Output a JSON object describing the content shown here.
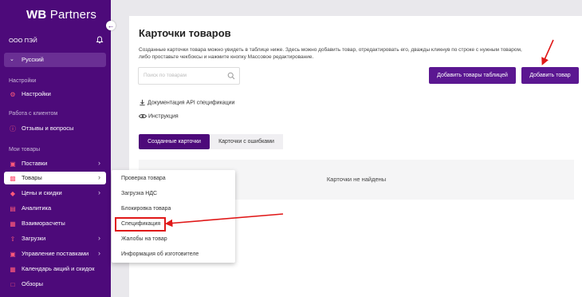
{
  "sidebar": {
    "logo_wb": "WB",
    "logo_partners": "Partners",
    "org_name": "ООО ПЭЙ",
    "language": "Русский",
    "sections": {
      "settings": "Настройки",
      "work_with_client": "Работа с клиентом",
      "my_goods": "Мои товары"
    },
    "items": {
      "settings": "Настройки",
      "reviews": "Отзывы и вопросы",
      "supplies": "Поставки",
      "goods": "Товары",
      "prices": "Цены и скидки",
      "analytics": "Аналитика",
      "settlements": "Взаиморасчеты",
      "uploads": "Загрузки",
      "supply_management": "Управление поставками",
      "promo_calendar": "Календарь акций и скидок",
      "reviews_overview": "Обзоры"
    }
  },
  "main": {
    "title": "Карточки товаров",
    "description": "Созданные карточки товара можно увидеть в таблице ниже. Здесь можно добавить товар, отредактировать его, дважды кликнув по строке с нужным товаром, либо проставьте чекбоксы и нажмите кнопку Массовое редактирование.",
    "search_placeholder": "Поиск по товарам",
    "add_table_button": "Добавить товары таблицей",
    "add_product_button": "Добавить товар",
    "api_doc_link": "Документация API спецификации",
    "instruction_link": "Инструкция",
    "tab_created": "Созданные карточки",
    "tab_errors": "Карточки с ошибками",
    "empty_text": "Карточки не найдены"
  },
  "dropdown": {
    "items": [
      "Проверка товара",
      "Загрузка НДС",
      "Блокировка товара",
      "Спецификация",
      "Жалобы на товар",
      "Информация об изготовителе"
    ]
  },
  "colors": {
    "sidebar_bg": "#4d0a7a",
    "button_purple": "#5b1791",
    "annotation_red": "#e01818",
    "icon_pink": "#ff5a7a"
  }
}
